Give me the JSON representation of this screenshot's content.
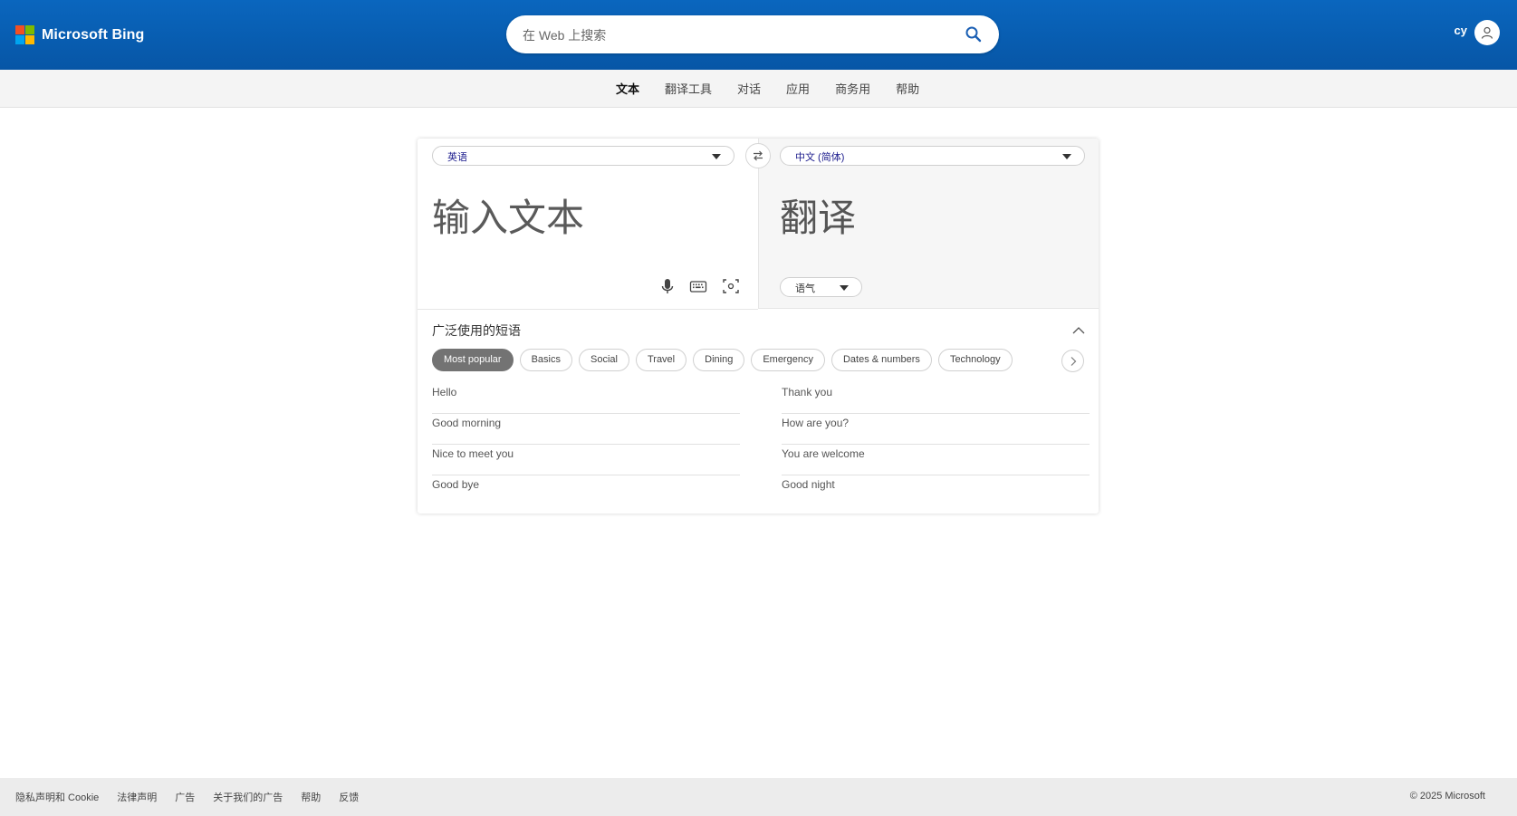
{
  "header": {
    "logo_text": "Microsoft Bing",
    "search_placeholder": "在 Web 上搜索",
    "user_name": "cy"
  },
  "nav": {
    "items": [
      "文本",
      "翻译工具",
      "对话",
      "应用",
      "商务用",
      "帮助"
    ],
    "active": "文本"
  },
  "translator": {
    "source_lang": "英语",
    "target_lang": "中文 (简体)",
    "source_placeholder": "输入文本",
    "target_placeholder": "翻译",
    "tone_label": "语气"
  },
  "phrases": {
    "title": "广泛使用的短语",
    "categories": [
      "Most popular",
      "Basics",
      "Social",
      "Travel",
      "Dining",
      "Emergency",
      "Dates & numbers",
      "Technology"
    ],
    "active_category": "Most popular",
    "left": [
      "Hello",
      "Good morning",
      "Nice to meet you",
      "Good bye"
    ],
    "right": [
      "Thank you",
      "How are you?",
      "You are welcome",
      "Good night"
    ]
  },
  "footer": {
    "links": [
      "隐私声明和 Cookie",
      "法律声明",
      "广告",
      "关于我们的广告",
      "帮助",
      "反馈"
    ],
    "copyright": "© 2025 Microsoft"
  },
  "colors": {
    "header_bg": "#0a66be",
    "active_chip": "#737373"
  }
}
